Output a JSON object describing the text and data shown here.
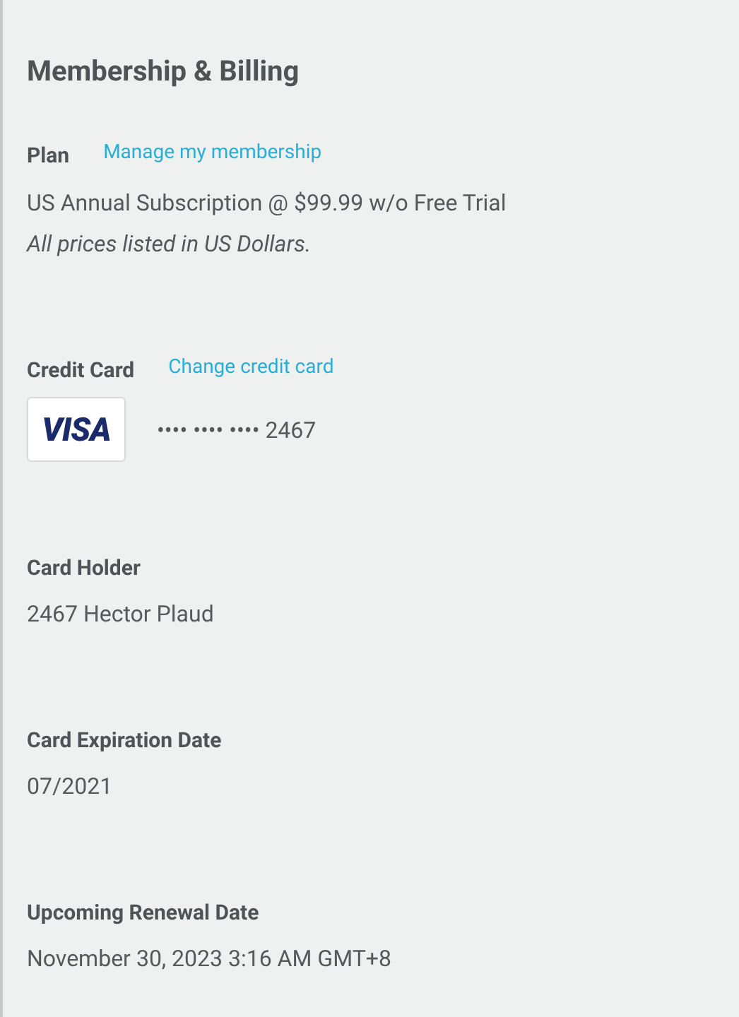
{
  "title": "Membership & Billing",
  "plan": {
    "label": "Plan",
    "link": "Manage my membership",
    "description": "US Annual Subscription @ $99.99 w/o Free Trial",
    "note": "All prices listed in US Dollars."
  },
  "credit_card": {
    "label": "Credit Card",
    "link": "Change credit card",
    "brand": "VISA",
    "masked_number": "•••• •••• •••• 2467"
  },
  "fields": [
    {
      "label": "Card Holder",
      "value": "2467 Hector Plaud"
    },
    {
      "label": "Card Expiration Date",
      "value": "07/2021"
    },
    {
      "label": "Upcoming Renewal Date",
      "value": "November 30, 2023 3:16 AM GMT+8"
    }
  ]
}
